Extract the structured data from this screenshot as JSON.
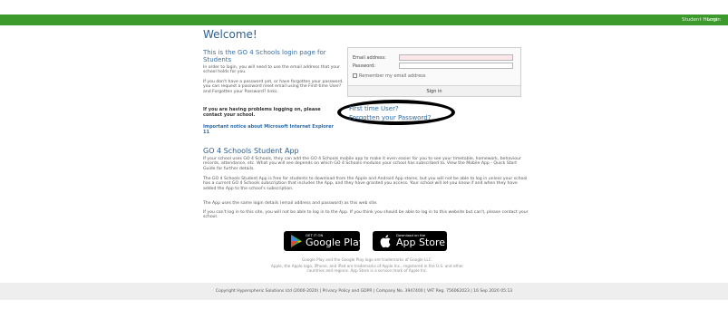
{
  "topbar": {
    "student_home": "Student Home",
    "login": "Login",
    "accent_color": "#3c9a2c"
  },
  "main": {
    "welcome": "Welcome!",
    "intro_title": "This is the GO 4 Schools login page for Students",
    "intro_p1": "In order to login, you will need to use the email address that your school holds for you.",
    "intro_p2": "If you don't have a password yet, or have forgotten your password, you can request a password reset email using the First-time User? and Forgotten your Password? links.",
    "problems": "If you are having problems logging on, please contact your school.",
    "notice": "Important notice about Microsoft Internet Explorer 11"
  },
  "login": {
    "email_label": "Email address:",
    "password_label": "Password:",
    "remember_label": "Remember my email address",
    "signin_button": "Sign in",
    "first_time_link": "First time User?",
    "forgot_link": "Forgotten your Password?"
  },
  "app": {
    "title": "GO 4 Schools Student App",
    "p1": "If your school uses GO 4 Schools, they can add the GO 4 Schools mobile app to make it even easier for you to see your timetable, homework, behaviour records, attendance, etc. What you will see depends on which GO 4 Schools modules your school has subscribed to. View the Mobile App - Quick Start Guide for further details.",
    "p2": "The GO 4 Schools Student App is free for students to download from the Apple and Android App stores, but you will not be able to log in unless your school has a current GO 4 Schools subscription that includes the App, and they have granted you access. Your school will let you know if and when they have added the App to the school's subscription.",
    "p3": "The App uses the same login details (email address and password) as this web site.",
    "p4": "If you can't log in to this site, you will not be able to log in to the App. If you think you should be able to log in to this website but can't, please contact your school."
  },
  "stores": {
    "google_small": "GET IT ON",
    "google_big": "Google Play",
    "apple_small": "Download on the",
    "apple_big": "App Store"
  },
  "trademarks": {
    "line1": "Google Play and the Google Play logo are trademarks of Google LLC.",
    "line2": "Apple, the Apple logo, iPhone, and iPad are trademarks of Apple Inc., registered in the U.S. and other countries and regions. App Store is a service mark of Apple Inc."
  },
  "footer": {
    "text": "Copyright Hyperspheric Solutions Ltd (2000-2020) | Privacy Policy and GDPR | Company No. 3947400 | VAT Reg. 756062023 | 16 Sep 2020 05:13"
  }
}
